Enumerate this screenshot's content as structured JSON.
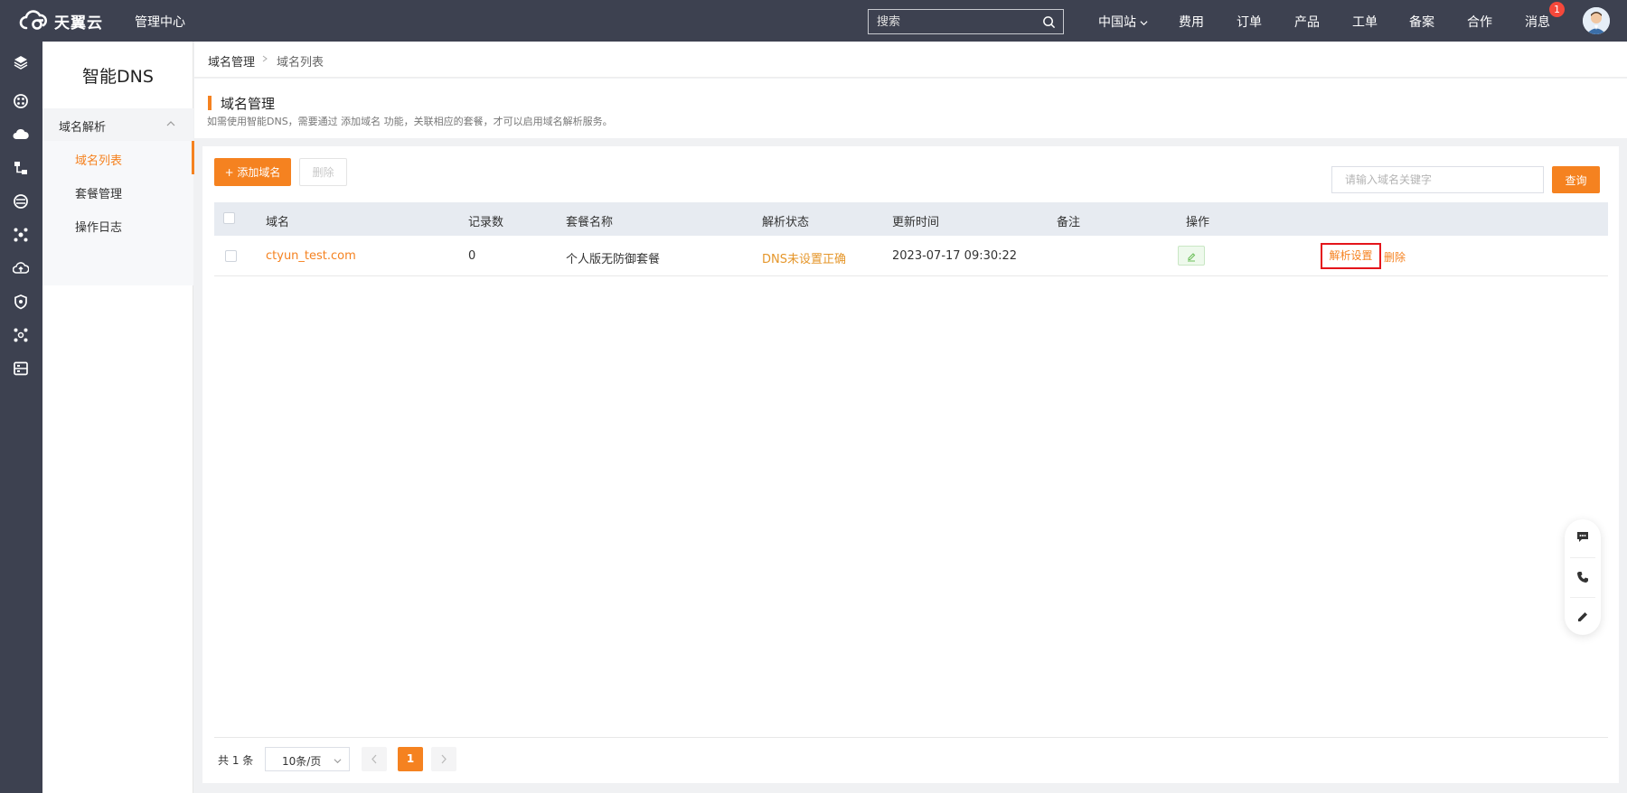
{
  "header": {
    "logo_text": "天翼云",
    "mgmt_label": "管理中心",
    "search_placeholder": "搜索",
    "region": "中国站",
    "nav": [
      "费用",
      "订单",
      "产品",
      "工单",
      "备案",
      "合作",
      "消息"
    ],
    "message_count": "1"
  },
  "rail": {
    "icons": [
      "layers-icon",
      "grid-icon",
      "cloud-icon",
      "network-icon",
      "database-icon",
      "cluster-icon",
      "cloud-upload-icon",
      "shield-icon",
      "link-icon",
      "storage-icon"
    ]
  },
  "sidebar": {
    "title": "智能DNS",
    "group": "域名解析",
    "items": [
      {
        "label": "域名列表",
        "active": true
      },
      {
        "label": "套餐管理",
        "active": false
      },
      {
        "label": "操作日志",
        "active": false
      }
    ]
  },
  "breadcrumb": [
    "域名管理",
    "域名列表"
  ],
  "page": {
    "title": "域名管理",
    "description": "如需使用智能DNS，需要通过 添加域名 功能，关联相应的套餐，才可以启用域名解析服务。"
  },
  "toolbar": {
    "add_label": "+ 添加域名",
    "delete_label": "删除",
    "keyword_placeholder": "请输入域名关键字",
    "query_label": "查询"
  },
  "table": {
    "columns": [
      "域名",
      "记录数",
      "套餐名称",
      "解析状态",
      "更新时间",
      "备注",
      "操作"
    ],
    "rows": [
      {
        "domain": "ctyun_test.com",
        "records": "0",
        "package": "个人版无防御套餐",
        "status": "DNS未设置正确",
        "updated": "2023-07-17 09:30:22",
        "op_setting": "解析设置",
        "op_delete": "删除"
      }
    ]
  },
  "pagination": {
    "total": "共 1 条",
    "page_size": "10条/页",
    "current": "1"
  },
  "colors": {
    "accent": "#f58220",
    "header_bg": "#3d4150",
    "highlight_border": "#e4151b"
  }
}
